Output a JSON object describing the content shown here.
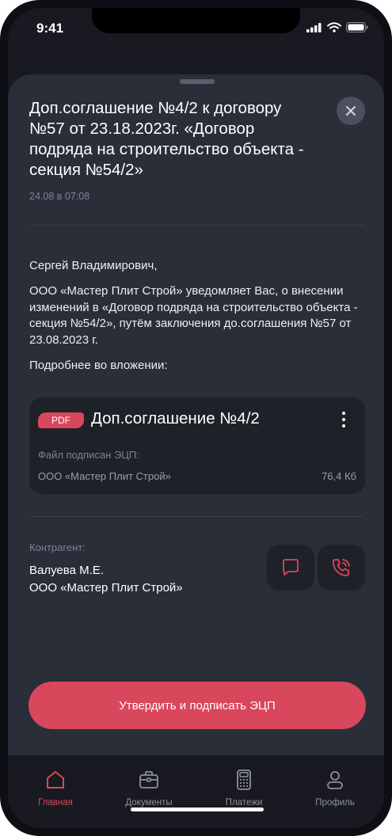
{
  "status_bar": {
    "time": "9:41"
  },
  "message": {
    "title": "Доп.соглашение №4/2 к договору №57 от 23.18.2023г. «Договор подряда на строительство объекта - секция №54/2»",
    "date": "24.08 в 07:08",
    "greeting": "Сергей Владимирович,",
    "body": "ООО «Мастер Плит Строй» уведомляет Вас, о внесении изменений в «Договор подряда на строительство объекта - секция №54/2», путём заключения до.соглашения №57 от 23.08.2023 г.",
    "details": "Подробнее во вложении:"
  },
  "attachment": {
    "badge": "PDF",
    "title": "Доп.соглашение №4/2",
    "caption": "Файл подписан ЭЦП:",
    "company": "ООО «Мастер Плит Строй»",
    "size": "76,4 Кб"
  },
  "contractor": {
    "label": "Контрагент:",
    "name": "Валуева М.Е.",
    "company": "ООО «Мастер Плит Строй»"
  },
  "primary_action": {
    "label": "Утвердить и подписать ЭЦП"
  },
  "tabs": [
    {
      "label": "Главная",
      "icon": "home-icon",
      "active": true
    },
    {
      "label": "Документы",
      "icon": "briefcase-icon",
      "active": false
    },
    {
      "label": "Платежи",
      "icon": "calculator-icon",
      "active": false
    },
    {
      "label": "Профиль",
      "icon": "user-icon",
      "active": false
    }
  ],
  "colors": {
    "accent": "#d9475d",
    "sheet": "#2a2e39",
    "background": "#191a21",
    "card": "#1f2129"
  }
}
